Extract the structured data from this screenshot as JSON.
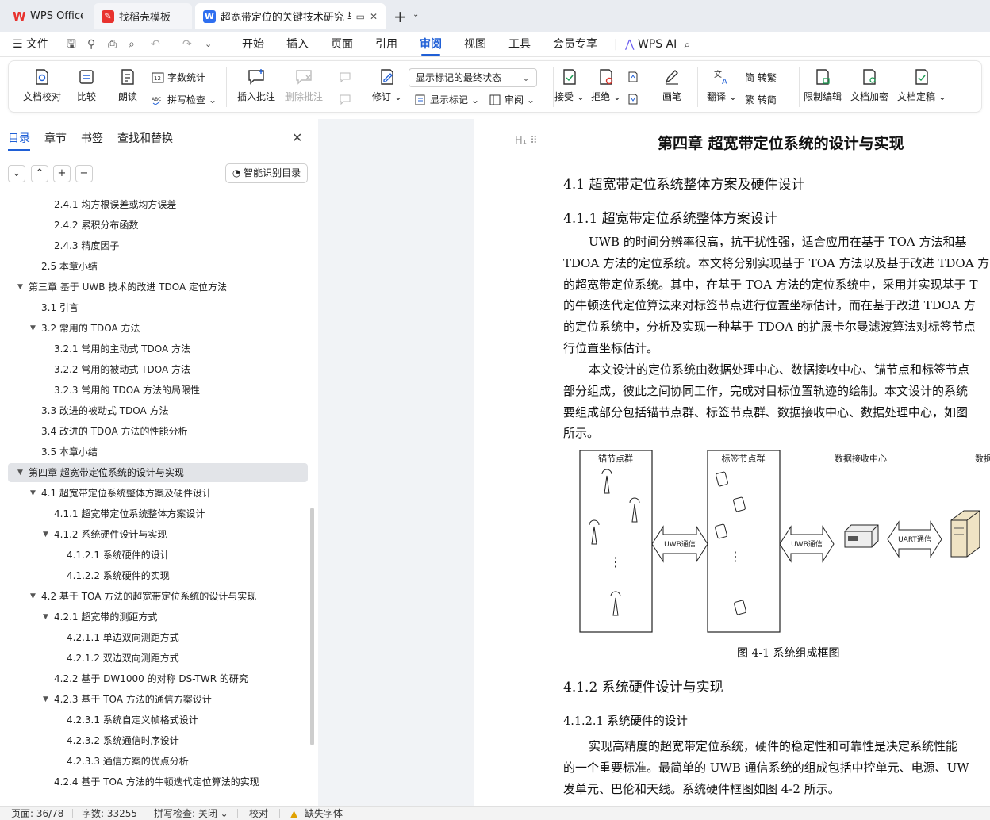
{
  "tabs": [
    {
      "label": "WPS Office",
      "icon": "wps-logo-icon",
      "color": "#e8322e"
    },
    {
      "label": "找稻壳模板",
      "icon": "docer-icon",
      "color": "#e8322e"
    },
    {
      "label": "超宽带定位的关键技术研究 毕",
      "icon": "writer-doc-icon",
      "color": "#2f6ff0"
    }
  ],
  "new_tab": "+",
  "menu": {
    "file": "文件",
    "items": [
      "开始",
      "插入",
      "页面",
      "引用",
      "审阅",
      "视图",
      "工具",
      "会员专享"
    ],
    "active": "审阅",
    "ai": "WPS AI"
  },
  "ribbon": {
    "doc_check": "文档校对",
    "compare": "比较",
    "read_aloud": "朗读",
    "word_count": "字数统计",
    "spell_check": "拼写检查",
    "insert_comment": "插入批注",
    "delete_comment": "删除批注",
    "revise": "修订",
    "markup_state": "显示标记的最终状态",
    "show_markup": "显示标记",
    "review": "审阅",
    "accept": "接受",
    "reject": "拒绝",
    "pen": "画笔",
    "translate": "翻译",
    "to_traditional": "简 转繁",
    "to_simplified": "繁 转简",
    "restrict_edit": "限制编辑",
    "encrypt": "文档加密",
    "finalize": "文档定稿"
  },
  "nav": {
    "tabs": [
      "目录",
      "章节",
      "书签",
      "查找和替换"
    ],
    "smart_toc": "智能识别目录",
    "toc": [
      {
        "text": "2.4.1  均方根误差或均方误差",
        "level": 3
      },
      {
        "text": "2.4.2  累积分布函数",
        "level": 3
      },
      {
        "text": "2.4.3  精度因子",
        "level": 3
      },
      {
        "text": "2.5  本章小结",
        "level": 2
      },
      {
        "text": "第三章  基于 UWB 技术的改进 TDOA 定位方法",
        "level": 1,
        "exp": true
      },
      {
        "text": "3.1  引言",
        "level": 2
      },
      {
        "text": "3.2  常用的 TDOA 方法",
        "level": 2,
        "exp": true
      },
      {
        "text": "3.2.1 常用的主动式 TDOA 方法",
        "level": 3
      },
      {
        "text": "3.2.2 常用的被动式 TDOA 方法",
        "level": 3
      },
      {
        "text": "3.2.3  常用的 TDOA 方法的局限性",
        "level": 3
      },
      {
        "text": "3.3  改进的被动式 TDOA 方法",
        "level": 2
      },
      {
        "text": "3.4  改进的 TDOA 方法的性能分析",
        "level": 2
      },
      {
        "text": "3.5  本章小结",
        "level": 2
      },
      {
        "text": "第四章  超宽带定位系统的设计与实现",
        "level": 1,
        "exp": true,
        "selected": true
      },
      {
        "text": "4.1  超宽带定位系统整体方案及硬件设计",
        "level": 2,
        "exp": true
      },
      {
        "text": "4.1.1  超宽带定位系统整体方案设计",
        "level": 3
      },
      {
        "text": "4.1.2  系统硬件设计与实现",
        "level": 3,
        "exp": true
      },
      {
        "text": "4.1.2.1  系统硬件的设计",
        "level": 4
      },
      {
        "text": "4.1.2.2  系统硬件的实现",
        "level": 4
      },
      {
        "text": "4.2  基于 TOA 方法的超宽带定位系统的设计与实现",
        "level": 2,
        "exp": true
      },
      {
        "text": "4.2.1  超宽带的测距方式",
        "level": 3,
        "exp": true
      },
      {
        "text": "4.2.1.1  单边双向测距方式",
        "level": 4
      },
      {
        "text": "4.2.1.2  双边双向测距方式",
        "level": 4
      },
      {
        "text": "4.2.2  基于 DW1000 的对称 DS-TWR 的研究",
        "level": 3
      },
      {
        "text": "4.2.3  基于 TOA 方法的通信方案设计",
        "level": 3,
        "exp": true
      },
      {
        "text": "4.2.3.1  系统自定义帧格式设计",
        "level": 4
      },
      {
        "text": "4.2.3.2  系统通信时序设计",
        "level": 4
      },
      {
        "text": "4.2.3.3  通信方案的优点分析",
        "level": 4
      },
      {
        "text": "4.2.4  基于 TOA 方法的牛顿迭代定位算法的实现",
        "level": 3
      }
    ]
  },
  "doc": {
    "heading_mark": "H",
    "chapter_title": "第四章  超宽带定位系统的设计与实现",
    "sec_4_1": "4.1  超宽带定位系统整体方案及硬件设计",
    "sec_4_1_1": "4.1.1  超宽带定位系统整体方案设计",
    "para1": [
      "UWB 的时间分辨率很高，抗干扰性强，适合应用在基于 TOA 方法和基",
      "TDOA 方法的定位系统。本文将分别实现基于 TOA 方法以及基于改进 TDOA 方",
      "的超宽带定位系统。其中，在基于 TOA 方法的定位系统中，采用并实现基于 T",
      "的牛顿迭代定位算法来对标签节点进行位置坐标估计，而在基于改进 TDOA 方",
      "的定位系统中，分析及实现一种基于 TDOA 的扩展卡尔曼滤波算法对标签节点",
      "行位置坐标估计。"
    ],
    "para2": [
      "本文设计的定位系统由数据处理中心、数据接收中心、锚节点和标签节点",
      "部分组成，彼此之间协同工作，完成对目标位置轨迹的绘制。本文设计的系统",
      "要组成部分包括锚节点群、标签节点群、数据接收中心、数据处理中心，如图",
      "所示。"
    ],
    "figure": {
      "anchor_group": "锚节点群",
      "tag_group": "标签节点群",
      "receiver": "数据接收中心",
      "processor": "数据处理中心",
      "link1": "UWB通信",
      "link2": "UWB通信",
      "link3": "UART通信",
      "dots": "⋮"
    },
    "fig_caption": "图 4-1  系统组成框图",
    "sec_4_1_2": "4.1.2  系统硬件设计与实现",
    "sec_4_1_2_1": "4.1.2.1  系统硬件的设计",
    "para3": [
      "实现高精度的超宽带定位系统，硬件的稳定性和可靠性是决定系统性能",
      "的一个重要标准。最简单的 UWB 通信系统的组成包括中控单元、电源、UW",
      "发单元、巴伦和天线。系统硬件框图如图 4-2 所示。"
    ]
  },
  "status": {
    "page": "页面: 36/78",
    "words": "字数: 33255",
    "spell": "拼写检查: 关闭",
    "proof": "校对",
    "missing_font": "缺失字体"
  },
  "colors": {
    "accent": "#1f5fd6",
    "selected_row": "#e2e4e8",
    "canvas_bg": "#f1f3f6"
  }
}
